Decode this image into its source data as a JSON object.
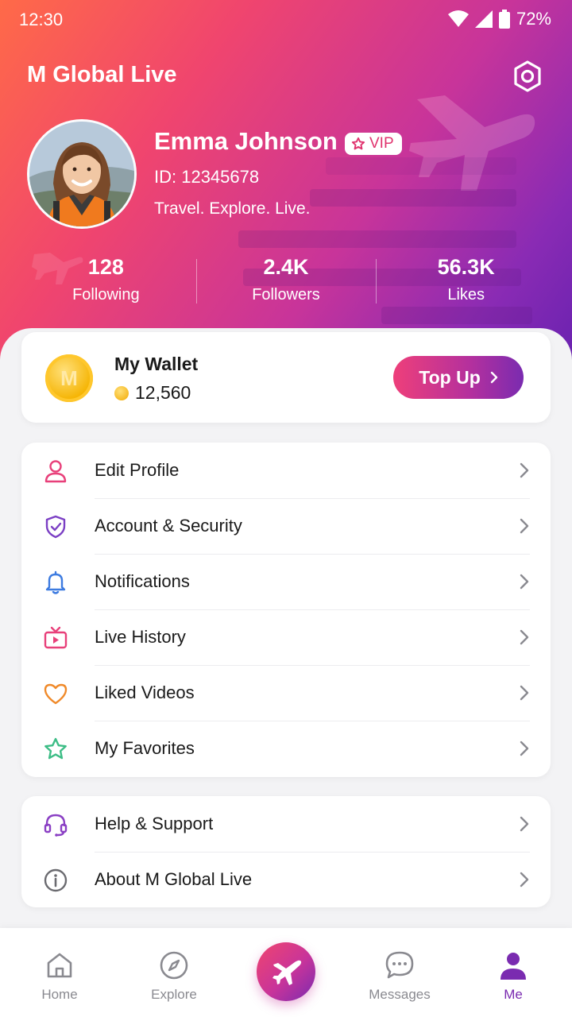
{
  "status_bar": {
    "time": "12:30",
    "battery": "72%"
  },
  "app": {
    "title": "M Global Live"
  },
  "profile": {
    "name": "Emma Johnson",
    "vip_label": "VIP",
    "id_text": "ID: 12345678",
    "bio": "Travel. Explore. Live."
  },
  "stats": [
    {
      "value": "128",
      "label": "Following"
    },
    {
      "value": "2.4K",
      "label": "Followers"
    },
    {
      "value": "56.3K",
      "label": "Likes"
    }
  ],
  "wallet": {
    "title": "My Wallet",
    "coin_letter": "M",
    "balance": "12,560",
    "topup_label": "Top Up"
  },
  "menu_primary": [
    {
      "label": "Edit Profile",
      "icon": "user-icon",
      "color": "#e8407a"
    },
    {
      "label": "Account & Security",
      "icon": "shield-check-icon",
      "color": "#7b3fc4"
    },
    {
      "label": "Notifications",
      "icon": "bell-icon",
      "color": "#3d7be0"
    },
    {
      "label": "Live History",
      "icon": "tv-play-icon",
      "color": "#e8407a"
    },
    {
      "label": "Liked Videos",
      "icon": "heart-icon",
      "color": "#f08a2a"
    },
    {
      "label": "My Favorites",
      "icon": "star-icon",
      "color": "#3dbd86"
    }
  ],
  "menu_secondary": [
    {
      "label": "Help & Support",
      "icon": "headset-icon",
      "color": "#8a3fc4"
    },
    {
      "label": "About M Global Live",
      "icon": "info-icon",
      "color": "#6b6b70"
    }
  ],
  "bottom_nav": [
    {
      "label": "Home",
      "icon": "home-icon"
    },
    {
      "label": "Explore",
      "icon": "compass-icon"
    },
    {
      "label": "",
      "icon": "airplane-icon"
    },
    {
      "label": "Messages",
      "icon": "chat-icon"
    },
    {
      "label": "Me",
      "icon": "person-icon",
      "active": true
    }
  ],
  "colors": {
    "accent": "#7a2bb0",
    "brand_pink": "#e8407a"
  }
}
